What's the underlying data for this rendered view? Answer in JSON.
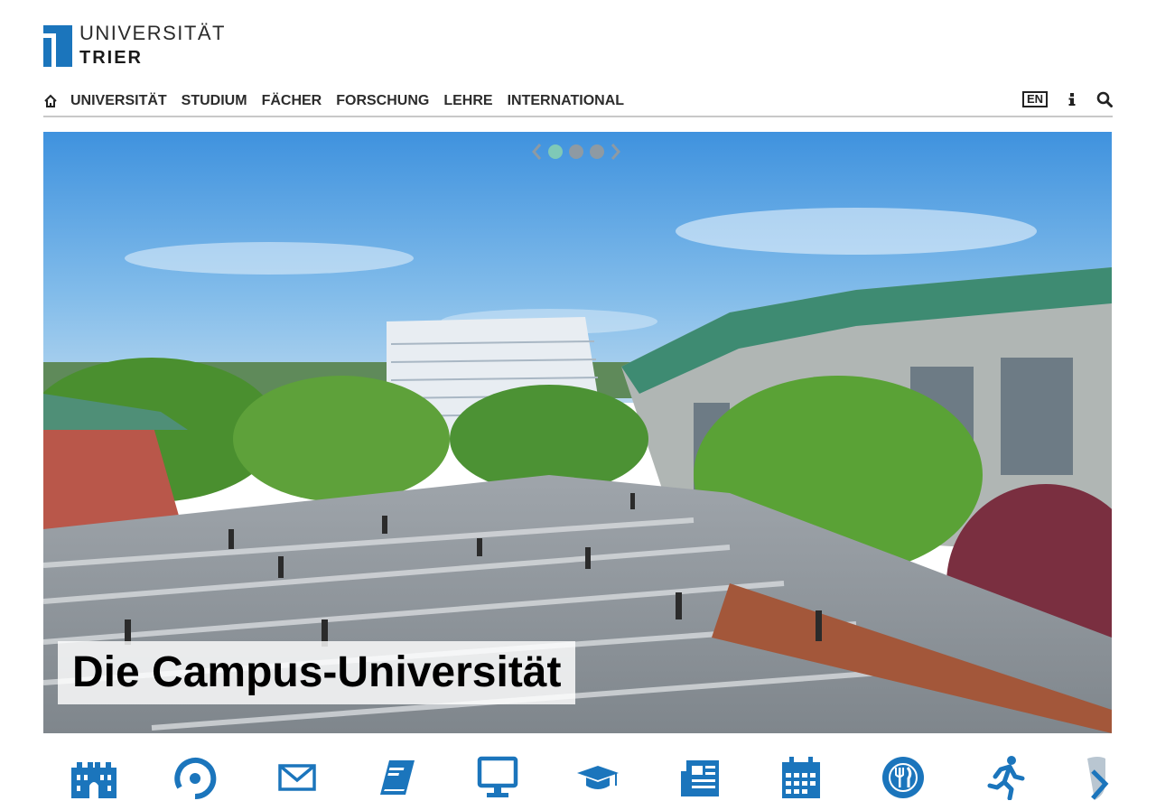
{
  "header": {
    "logo_line1": "UNIVERSITÄT",
    "logo_line2": "TRIER"
  },
  "nav": {
    "home_icon": "home-icon",
    "items": [
      {
        "label": "UNIVERSITÄT"
      },
      {
        "label": "STUDIUM"
      },
      {
        "label": "FÄCHER"
      },
      {
        "label": "FORSCHUNG"
      },
      {
        "label": "LEHRE"
      },
      {
        "label": "INTERNATIONAL"
      }
    ],
    "language_label": "EN",
    "info_icon": "info-icon",
    "search_icon": "search-icon"
  },
  "hero": {
    "caption": "Die Campus-Universität",
    "slides_total": 3,
    "active_slide": 1
  },
  "quicklinks": [
    {
      "icon": "campus-building-icon"
    },
    {
      "icon": "location-pin-icon"
    },
    {
      "icon": "mail-icon"
    },
    {
      "icon": "book-icon"
    },
    {
      "icon": "computer-icon"
    },
    {
      "icon": "graduation-cap-icon"
    },
    {
      "icon": "newspaper-icon"
    },
    {
      "icon": "calendar-icon"
    },
    {
      "icon": "dining-icon"
    },
    {
      "icon": "running-icon"
    },
    {
      "icon": "shield-icon"
    }
  ],
  "colors": {
    "accent_blue": "#1b75bc",
    "nav_text": "#2c2c2c",
    "active_dot": "#7fc9b7",
    "logo_blue": "#1b75bc"
  }
}
